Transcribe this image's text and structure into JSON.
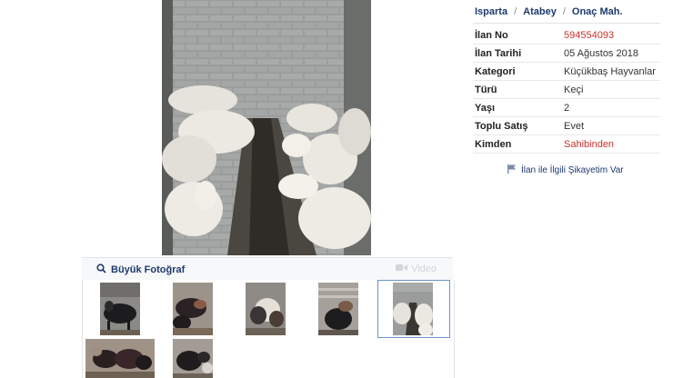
{
  "breadcrumb": {
    "city": "Isparta",
    "district": "Atabey",
    "neighborhood": "Onaç Mah.",
    "separator": "/"
  },
  "details": [
    {
      "key": "İlan No",
      "value": "594554093",
      "value_color": "#c8312d"
    },
    {
      "key": "İlan Tarihi",
      "value": "05 Ağustos 2018"
    },
    {
      "key": "Kategori",
      "value": "Küçükbaş Hayvanlar"
    },
    {
      "key": "Türü",
      "value": "Keçi"
    },
    {
      "key": "Yaşı",
      "value": "2"
    },
    {
      "key": "Toplu Satış",
      "value": "Evet"
    },
    {
      "key": "Kimden",
      "value": "Sahibinden",
      "value_color": "#c8312d"
    }
  ],
  "complaint_link": {
    "label": "İlan ile İlgili Şikayetim Var",
    "icon": "flag-icon"
  },
  "photo_bar": {
    "big_photo_label": "Büyük Fotoğraf",
    "big_photo_icon": "search-icon",
    "video_label": "Video",
    "video_icon": "camera-icon"
  },
  "thumbnails": {
    "count": 7,
    "selected_index": 4
  },
  "colors": {
    "link": "#1e3a6e",
    "accent_red": "#c8312d",
    "selected_border": "#6c93c9"
  }
}
